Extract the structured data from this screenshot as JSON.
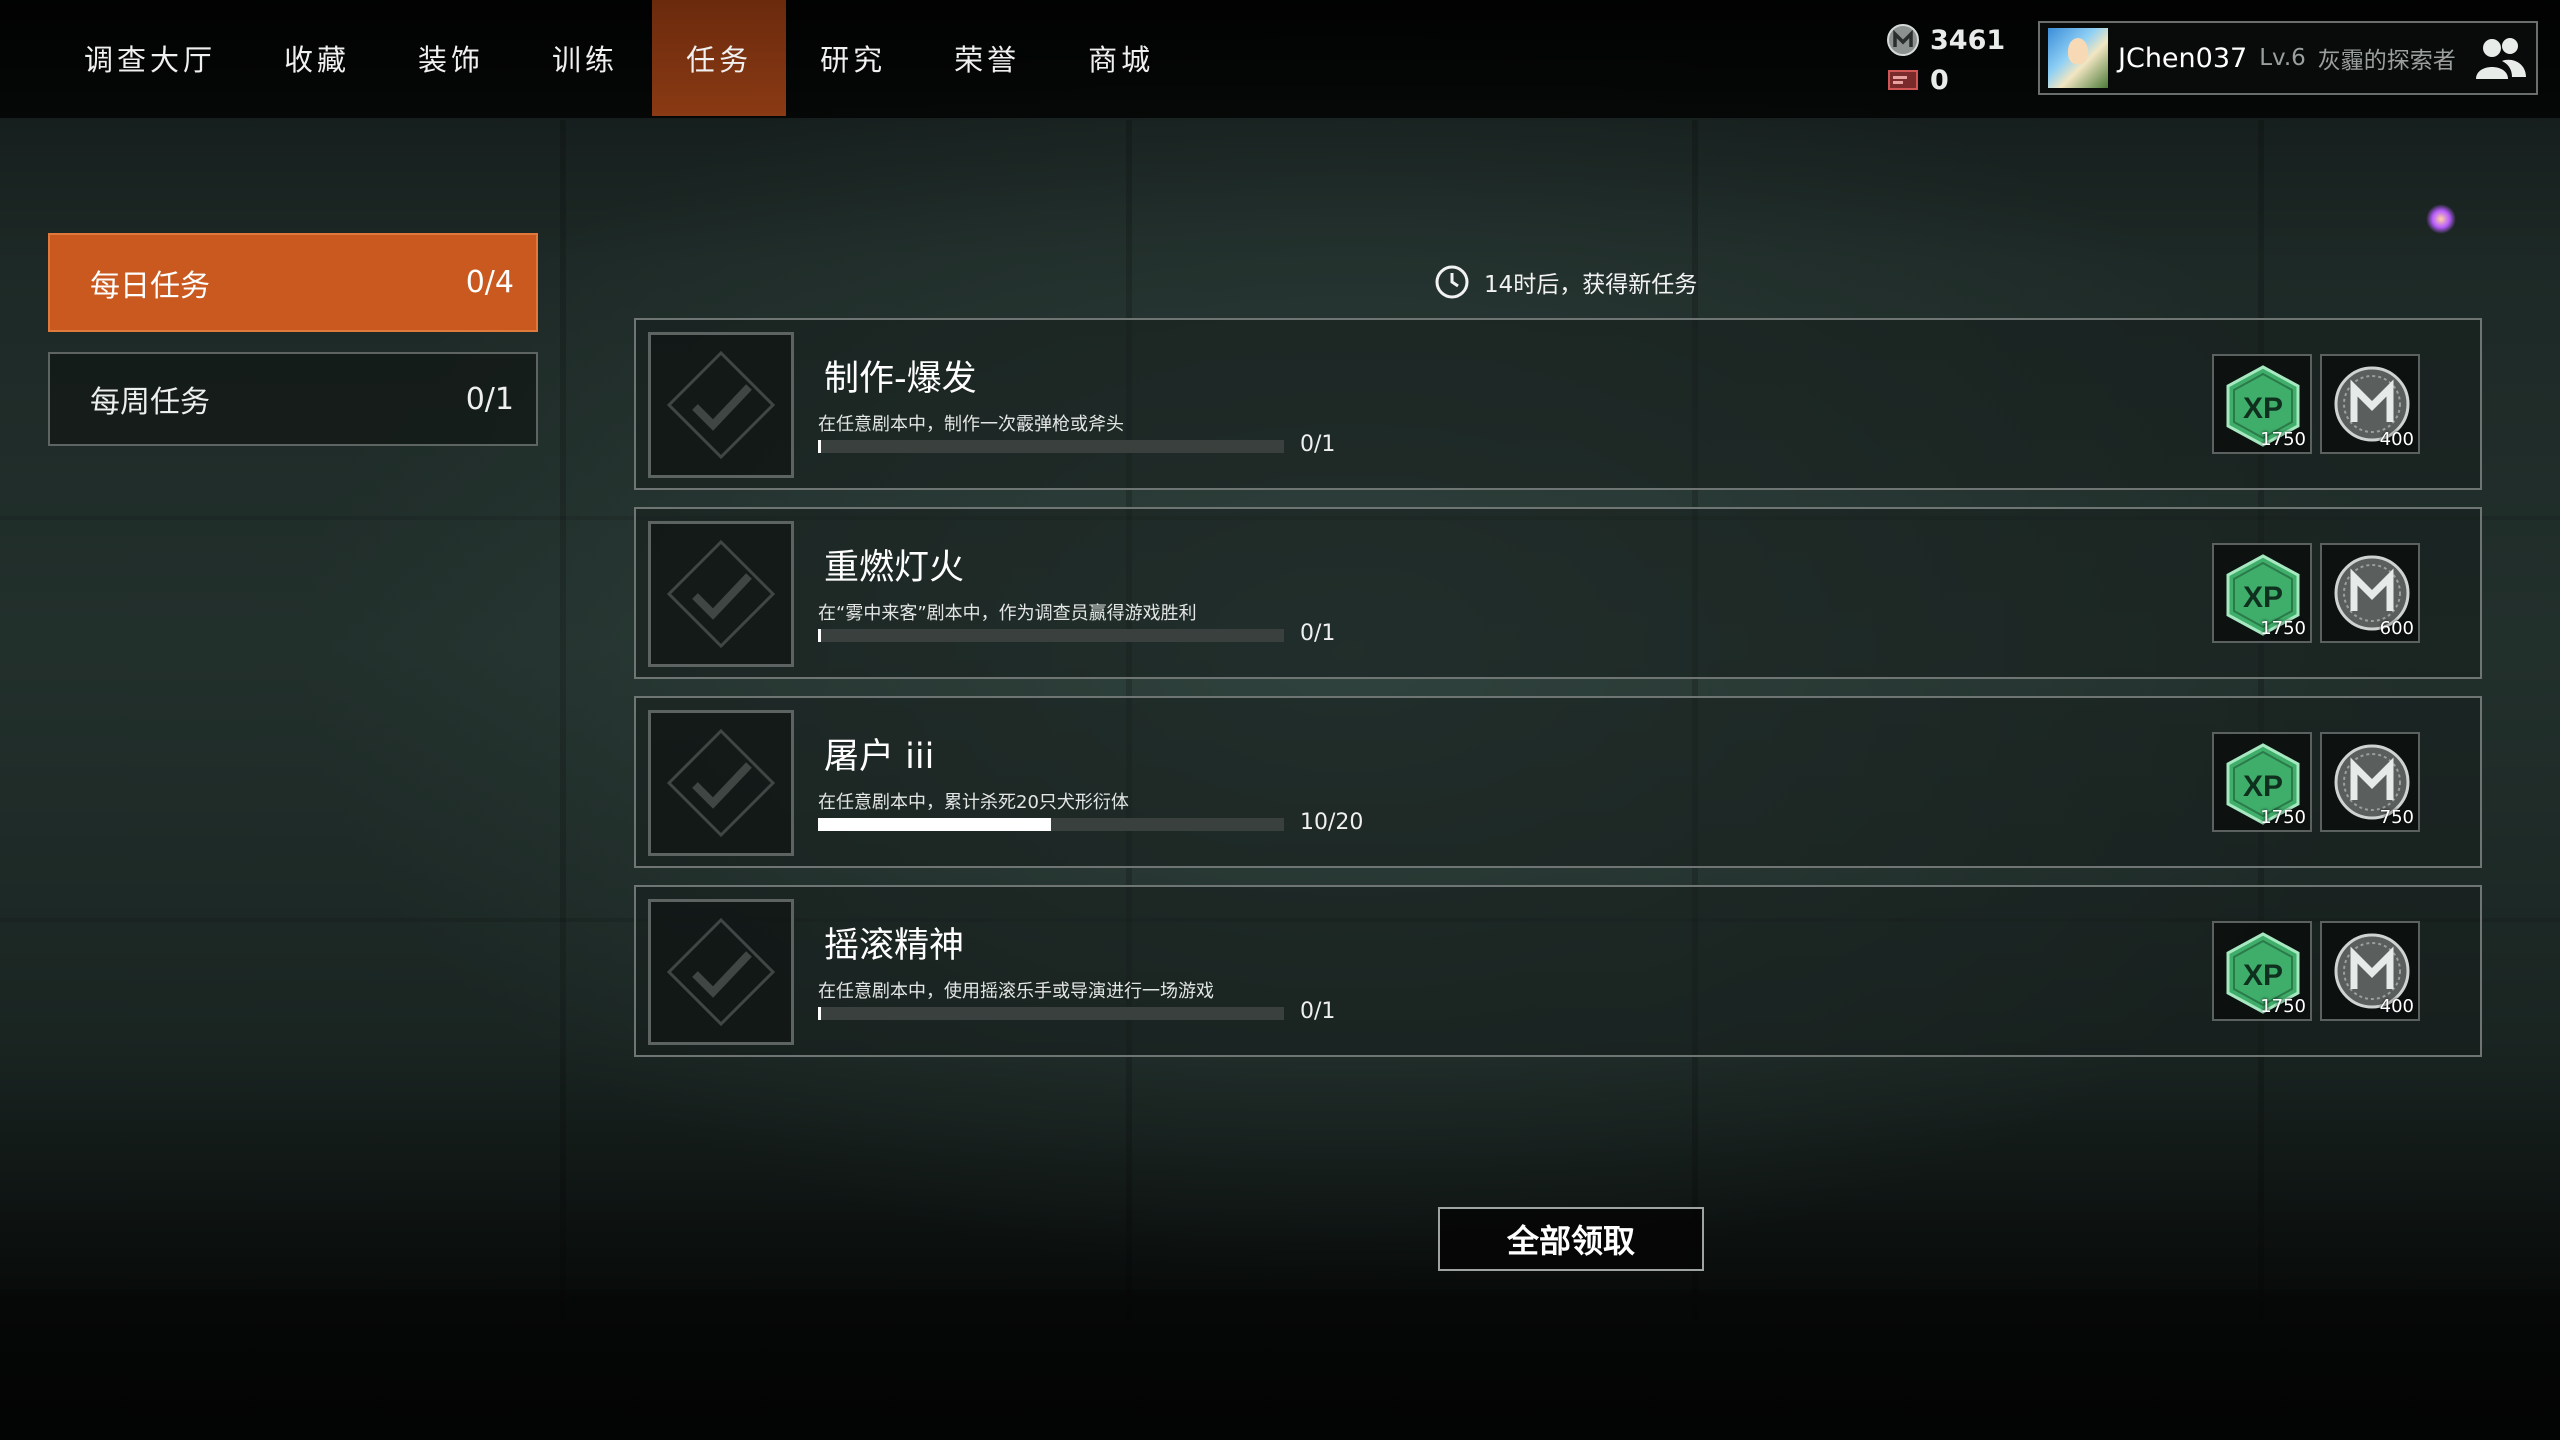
{
  "nav": {
    "items": [
      {
        "label": "调查大厅",
        "active": false
      },
      {
        "label": "收藏",
        "active": false
      },
      {
        "label": "装饰",
        "active": false
      },
      {
        "label": "训练",
        "active": false
      },
      {
        "label": "任务",
        "active": true
      },
      {
        "label": "研究",
        "active": false
      },
      {
        "label": "荣誉",
        "active": false
      },
      {
        "label": "商城",
        "active": false
      }
    ]
  },
  "currency": {
    "coins": "3461",
    "tickets": "0"
  },
  "profile": {
    "name": "JChen037",
    "level": "Lv.6",
    "title": "灰霾的探索者"
  },
  "tabs": {
    "daily": {
      "label": "每日任务",
      "count": "0/4"
    },
    "weekly": {
      "label": "每周任务",
      "count": "0/1"
    }
  },
  "timer": "14时后，获得新任务",
  "quests": [
    {
      "title": "制作-爆发",
      "desc": "在任意剧本中，制作一次霰弹枪或斧头",
      "progress": "0/1",
      "fraction": 0.0,
      "xp": "1750",
      "coins": "400"
    },
    {
      "title": "重燃灯火",
      "desc": "在“雾中来客”剧本中，作为调查员赢得游戏胜利",
      "progress": "0/1",
      "fraction": 0.0,
      "xp": "1750",
      "coins": "600"
    },
    {
      "title": "屠户 iii",
      "desc": "在任意剧本中，累计杀死20只犬形衍体",
      "progress": "10/20",
      "fraction": 0.5,
      "xp": "1750",
      "coins": "750"
    },
    {
      "title": "摇滚精神",
      "desc": "在任意剧本中，使用摇滚乐手或导演进行一场游戏",
      "progress": "0/1",
      "fraction": 0.0,
      "xp": "1750",
      "coins": "400"
    }
  ],
  "claim_all": "全部领取",
  "colors": {
    "accent": "#c9591e",
    "nav_active": "#8a3a14",
    "xp_green": "#3fae6a"
  }
}
